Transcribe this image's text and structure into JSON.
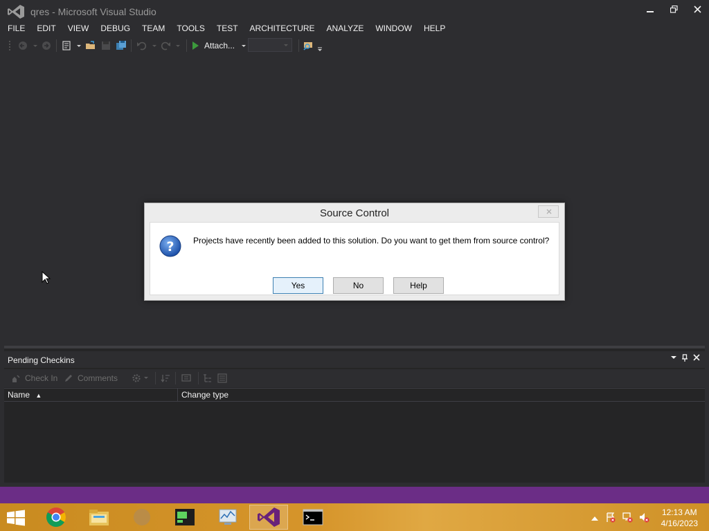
{
  "window": {
    "title": "qres - Microsoft Visual Studio"
  },
  "menu": [
    "FILE",
    "EDIT",
    "VIEW",
    "DEBUG",
    "TEAM",
    "TOOLS",
    "TEST",
    "ARCHITECTURE",
    "ANALYZE",
    "WINDOW",
    "HELP"
  ],
  "toolbar": {
    "attach_label": "Attach..."
  },
  "dialog": {
    "title": "Source Control",
    "message": "Projects have recently been added to this solution. Do you want to get them from source control?",
    "yes_label": "Yes",
    "no_label": "No",
    "help_label": "Help"
  },
  "pending_checkins": {
    "title": "Pending Checkins",
    "check_in_label": "Check In",
    "comments_label": "Comments",
    "columns": [
      "Name",
      "Change type"
    ],
    "sort_indicator": "▲"
  },
  "taskbar": {
    "apps": [
      "chrome-icon",
      "file-explorer-icon",
      "app-icon",
      "terminal-green-icon",
      "resource-monitor-icon",
      "visual-studio-icon",
      "cmd-icon"
    ],
    "active_app": "visual-studio-icon",
    "clock_time": "12:13 AM",
    "clock_date": "4/16/2023"
  },
  "colors": {
    "accent_purple": "#68217a",
    "ide_background": "#2d2d30",
    "taskbar_orange": "#d6952b",
    "strip_purple": "#6b2d86"
  }
}
